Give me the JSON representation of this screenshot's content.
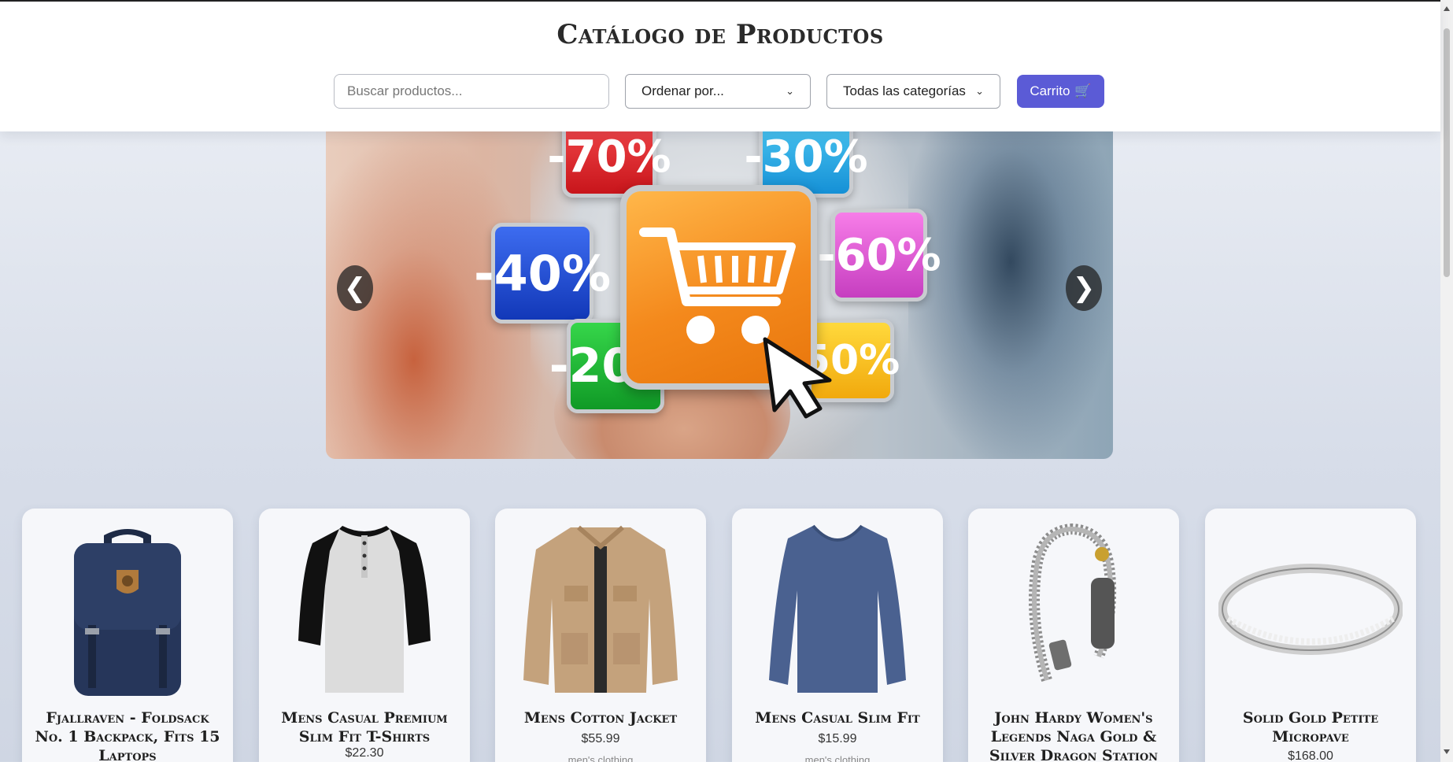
{
  "header": {
    "title": "Catálogo de Productos",
    "search_placeholder": "Buscar productos...",
    "sort_label": "Ordenar por...",
    "category_label": "Todas las categorías",
    "cart_label": "Carrito",
    "cart_icon": "🛒"
  },
  "carousel": {
    "prev_label": "❮",
    "next_label": "❯",
    "discounts": [
      "-70%",
      "-30%",
      "-40%",
      "-60%",
      "-20%",
      "50%"
    ]
  },
  "products": [
    {
      "title": "Fjallraven - Foldsack No. 1 Backpack, Fits 15 Laptops",
      "price": "",
      "category": ""
    },
    {
      "title": "Mens Casual Premium Slim Fit T-Shirts",
      "price": "$22.30",
      "category": ""
    },
    {
      "title": "Mens Cotton Jacket",
      "price": "$55.99",
      "category": "men's clothing"
    },
    {
      "title": "Mens Casual Slim Fit",
      "price": "$15.99",
      "category": "men's clothing"
    },
    {
      "title": "John Hardy Women's Legends Naga Gold & Silver Dragon Station",
      "price": "",
      "category": ""
    },
    {
      "title": "Solid Gold Petite Micropave",
      "price": "$168.00",
      "category": ""
    }
  ],
  "colors": {
    "accent": "#5b5bd6",
    "background": "#dde2ec"
  }
}
